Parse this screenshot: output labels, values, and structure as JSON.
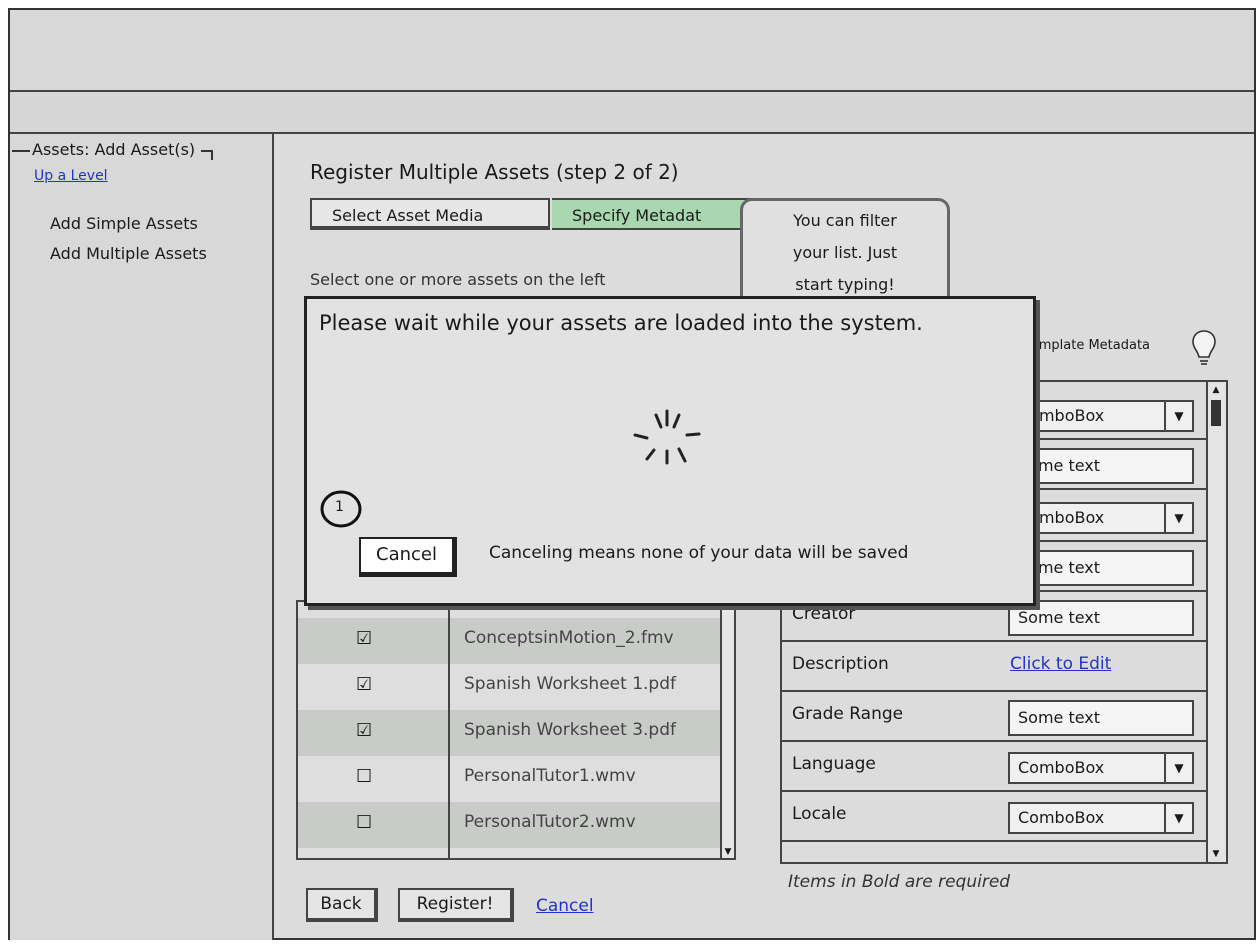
{
  "sidebar": {
    "title": "Assets: Add Asset(s)",
    "up_link": "Up a Level",
    "items": [
      {
        "label": "Add Simple Assets"
      },
      {
        "label": "Add Multiple Assets"
      }
    ]
  },
  "main": {
    "title": "Register Multiple Assets (step 2 of 2)",
    "tabs": [
      {
        "label": "Select Asset Media"
      },
      {
        "label": "Specify Metadat"
      }
    ],
    "hint": "Select one or more assets on the left",
    "tip_lines": [
      "You can filter",
      "your list.  Just",
      "start typing!"
    ],
    "template_metadata_label": "Template Metadata",
    "files": [
      {
        "name": "ConceptsinMotion_2.fmv",
        "checked": true
      },
      {
        "name": "Spanish Worksheet 1.pdf",
        "checked": true
      },
      {
        "name": "Spanish Worksheet 3.pdf",
        "checked": true
      },
      {
        "name": "PersonalTutor1.wmv",
        "checked": false
      },
      {
        "name": "PersonalTutor2.wmv",
        "checked": false
      }
    ],
    "metadata_rows": [
      {
        "label": "",
        "type": "combo",
        "value": "ComboBox"
      },
      {
        "label": "",
        "type": "text",
        "value": "Some text"
      },
      {
        "label": "",
        "type": "combo",
        "value": "ComboBox"
      },
      {
        "label": "",
        "type": "text",
        "value": "Some text"
      },
      {
        "label": "Creator",
        "type": "text",
        "value": "Some text"
      },
      {
        "label": "Description",
        "type": "link",
        "value": "Click to Edit"
      },
      {
        "label": "Grade Range",
        "type": "text",
        "value": "Some text"
      },
      {
        "label": "Language",
        "type": "combo",
        "value": "ComboBox"
      },
      {
        "label": "Locale",
        "type": "combo",
        "value": "ComboBox"
      }
    ],
    "required_note": "Items in Bold are required",
    "buttons": {
      "back": "Back",
      "register": "Register!",
      "cancel": "Cancel"
    }
  },
  "dialog": {
    "message": "Please wait while your assets are loaded into the system.",
    "cancel_label": "Cancel",
    "warning": "Canceling means none of your data will be saved",
    "marker_number": "1"
  },
  "icons": {
    "checked": "☑",
    "unchecked": "☐",
    "dropdown": "▼",
    "scroll_up": "▲",
    "scroll_down": "▼"
  },
  "colors": {
    "active_tab": "#a9d7b0",
    "link": "#2233cc",
    "alt_row": "#c8cbc8"
  }
}
